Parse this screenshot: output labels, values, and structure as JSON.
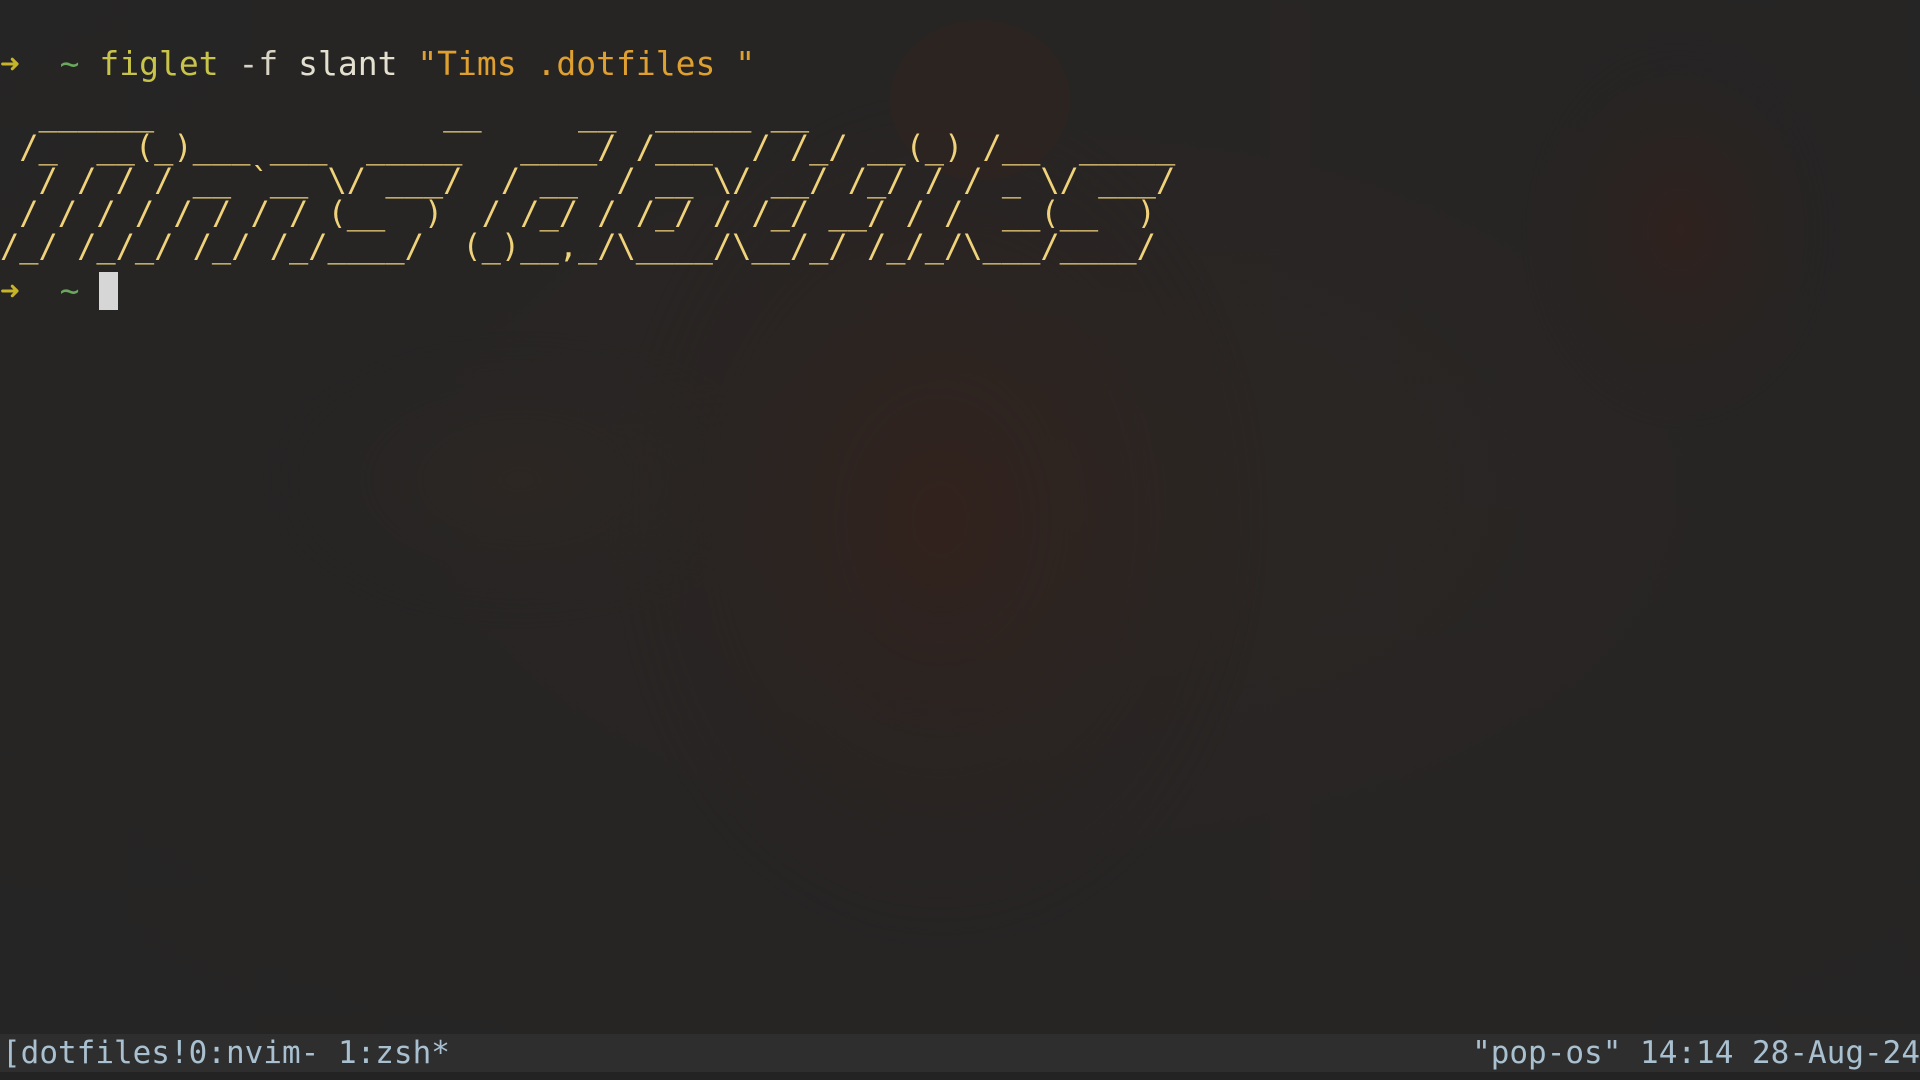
{
  "terminal": {
    "prompt_arrow": "➜",
    "prompt_dir": "~",
    "command": {
      "program": "figlet",
      "flag": "-f",
      "font": "slant",
      "text_arg": "\"Tims .dotfiles \""
    },
    "figlet_output": [
      "  ______               __     __  _____ __",
      " /_  __(_)___ ___  _____   ____/ /___  / /_/ __(_) /__  _____",
      "  / / / / __ `__ \\/ ___/  / __  / __ \\/ __/ /_/ / / _ \\/ ___/",
      " / / / / / / / / (__  )  / /_/ / /_/ / /_/ __/ / /  __(__  )",
      "/_/ /_/_/ /_/ /_/____/  (_)__,_/\\____/\\__/_/ /_/_/\\___/____/"
    ]
  },
  "statusbar": {
    "left": "[dotfiles!0:nvim- 1:zsh*",
    "right": "\"pop-os\" 14:14 28-Aug-24"
  },
  "colors": {
    "background": "#262626",
    "prompt_arrow": "#c8b428",
    "prompt_dir": "#6aa85c",
    "command": "#c8c44a",
    "string": "#e0a030",
    "figlet": "#f0d27a",
    "statusbar_text": "#a8c0d0",
    "statusbar_bg": "#2e2e2e",
    "cursor": "#d6d6d6"
  }
}
